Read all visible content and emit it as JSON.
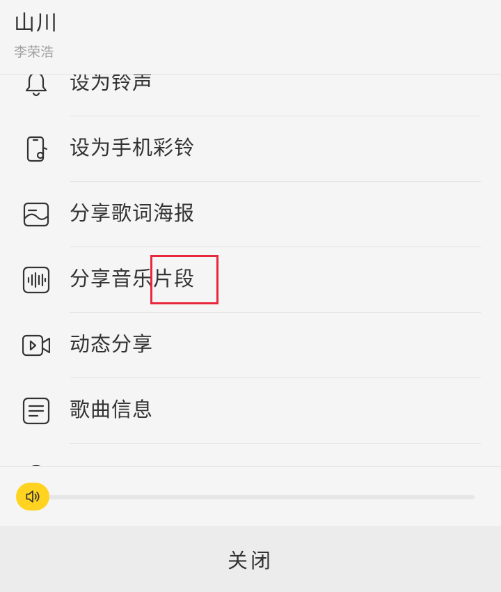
{
  "song": {
    "title": "山川",
    "artist": "李荣浩"
  },
  "menu": {
    "items": [
      {
        "label": "设为铃声",
        "icon": "bell-icon"
      },
      {
        "label": "设为手机彩铃",
        "icon": "phone-music-icon"
      },
      {
        "label": "分享歌词海报",
        "icon": "image-icon"
      },
      {
        "label": "分享音乐片段",
        "icon": "audio-wave-icon"
      },
      {
        "label": "动态分享",
        "icon": "video-camera-icon"
      },
      {
        "label": "歌曲信息",
        "icon": "document-icon"
      }
    ]
  },
  "volume": {
    "level": 0.0
  },
  "footer": {
    "close_label": "关闭"
  },
  "colors": {
    "accent": "#ffd320",
    "highlight": "#e8263c"
  }
}
